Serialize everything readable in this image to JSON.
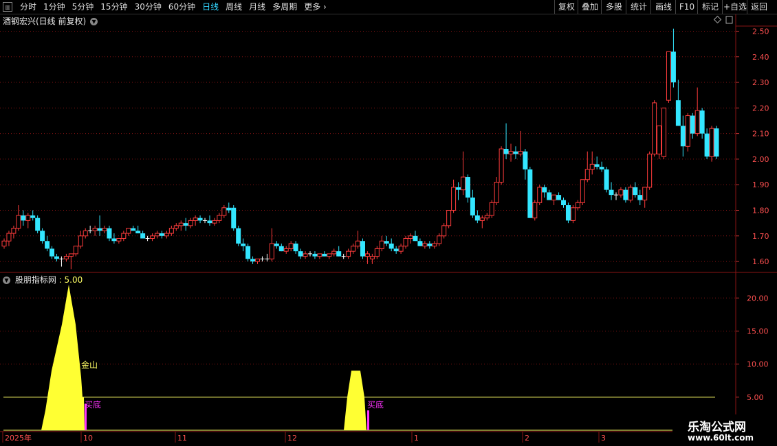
{
  "toolbar": {
    "periods": [
      "分时",
      "1分钟",
      "5分钟",
      "15分钟",
      "30分钟",
      "60分钟",
      "日线",
      "周线",
      "月线",
      "多周期",
      "更多"
    ],
    "active_period": "日线",
    "right_buttons": [
      "复权",
      "叠加",
      "多股",
      "统计",
      "画线",
      "F10",
      "标记",
      "+自选",
      "返回"
    ]
  },
  "main_panel": {
    "title": "酒钢宏兴(日线 前复权)",
    "y_ticks": [
      "2.50",
      "2.40",
      "2.30",
      "2.20",
      "2.10",
      "2.00",
      "1.90",
      "1.80",
      "1.70",
      "1.60"
    ]
  },
  "indicator_panel": {
    "title": "股朋指标网",
    "value": ": 5.00",
    "y_ticks": [
      "20.00",
      "15.00",
      "10.00",
      "5.00"
    ],
    "labels": {
      "jinshan": "金山",
      "buy1": "买底",
      "buy2": "买底"
    }
  },
  "x_axis": {
    "labels": [
      "2025年",
      "10",
      "11",
      "12",
      "1",
      "2",
      "3"
    ]
  },
  "colors": {
    "up": "#ff3c3c",
    "down": "#33e6ff",
    "doji": "#ffffff",
    "area": "#ffff33",
    "buy": "#ff33ff",
    "grid": "#8a1414"
  },
  "chart_data": {
    "type": "candlestick",
    "ylim": [
      1.56,
      2.52
    ],
    "candles": [
      [
        1.66,
        1.69,
        1.65,
        1.68
      ],
      [
        1.68,
        1.72,
        1.66,
        1.71
      ],
      [
        1.71,
        1.74,
        1.69,
        1.73
      ],
      [
        1.73,
        1.82,
        1.72,
        1.78
      ],
      [
        1.78,
        1.8,
        1.74,
        1.76
      ],
      [
        1.76,
        1.79,
        1.73,
        1.78
      ],
      [
        1.78,
        1.8,
        1.76,
        1.77
      ],
      [
        1.77,
        1.78,
        1.71,
        1.72
      ],
      [
        1.72,
        1.73,
        1.67,
        1.68
      ],
      [
        1.68,
        1.7,
        1.64,
        1.65
      ],
      [
        1.65,
        1.66,
        1.61,
        1.62
      ],
      [
        1.62,
        1.63,
        1.6,
        1.61
      ],
      [
        1.61,
        1.62,
        1.58,
        1.61
      ],
      [
        1.61,
        1.63,
        1.6,
        1.62
      ],
      [
        1.62,
        1.63,
        1.57,
        1.63
      ],
      [
        1.63,
        1.66,
        1.62,
        1.66
      ],
      [
        1.66,
        1.72,
        1.65,
        1.7
      ],
      [
        1.7,
        1.73,
        1.69,
        1.72
      ],
      [
        1.72,
        1.74,
        1.71,
        1.72
      ],
      [
        1.72,
        1.74,
        1.7,
        1.73
      ],
      [
        1.73,
        1.78,
        1.7,
        1.72
      ],
      [
        1.72,
        1.74,
        1.71,
        1.73
      ],
      [
        1.73,
        1.74,
        1.68,
        1.69
      ],
      [
        1.69,
        1.71,
        1.67,
        1.68
      ],
      [
        1.68,
        1.69,
        1.67,
        1.69
      ],
      [
        1.69,
        1.72,
        1.68,
        1.71
      ],
      [
        1.71,
        1.73,
        1.7,
        1.73
      ],
      [
        1.73,
        1.74,
        1.72,
        1.72
      ],
      [
        1.72,
        1.74,
        1.71,
        1.71
      ],
      [
        1.71,
        1.72,
        1.69,
        1.69
      ],
      [
        1.69,
        1.7,
        1.68,
        1.69
      ],
      [
        1.69,
        1.71,
        1.68,
        1.7
      ],
      [
        1.7,
        1.72,
        1.69,
        1.71
      ],
      [
        1.71,
        1.72,
        1.69,
        1.7
      ],
      [
        1.7,
        1.72,
        1.69,
        1.71
      ],
      [
        1.71,
        1.74,
        1.7,
        1.73
      ],
      [
        1.73,
        1.75,
        1.72,
        1.74
      ],
      [
        1.74,
        1.76,
        1.72,
        1.75
      ],
      [
        1.75,
        1.77,
        1.72,
        1.74
      ],
      [
        1.74,
        1.77,
        1.73,
        1.76
      ],
      [
        1.76,
        1.78,
        1.74,
        1.77
      ],
      [
        1.77,
        1.78,
        1.75,
        1.76
      ],
      [
        1.76,
        1.77,
        1.75,
        1.76
      ],
      [
        1.76,
        1.78,
        1.74,
        1.75
      ],
      [
        1.75,
        1.77,
        1.74,
        1.76
      ],
      [
        1.76,
        1.79,
        1.75,
        1.78
      ],
      [
        1.78,
        1.82,
        1.77,
        1.81
      ],
      [
        1.81,
        1.83,
        1.79,
        1.8
      ],
      [
        1.81,
        1.82,
        1.72,
        1.73
      ],
      [
        1.73,
        1.74,
        1.66,
        1.67
      ],
      [
        1.67,
        1.69,
        1.64,
        1.66
      ],
      [
        1.66,
        1.67,
        1.6,
        1.61
      ],
      [
        1.61,
        1.62,
        1.59,
        1.6
      ],
      [
        1.6,
        1.61,
        1.59,
        1.61
      ],
      [
        1.61,
        1.62,
        1.6,
        1.61
      ],
      [
        1.61,
        1.63,
        1.6,
        1.61
      ],
      [
        1.61,
        1.73,
        1.6,
        1.67
      ],
      [
        1.67,
        1.68,
        1.65,
        1.66
      ],
      [
        1.66,
        1.67,
        1.64,
        1.64
      ],
      [
        1.64,
        1.66,
        1.63,
        1.65
      ],
      [
        1.65,
        1.68,
        1.64,
        1.67
      ],
      [
        1.67,
        1.68,
        1.63,
        1.64
      ],
      [
        1.64,
        1.65,
        1.61,
        1.62
      ],
      [
        1.62,
        1.64,
        1.61,
        1.63
      ],
      [
        1.63,
        1.64,
        1.62,
        1.63
      ],
      [
        1.63,
        1.64,
        1.61,
        1.62
      ],
      [
        1.62,
        1.63,
        1.61,
        1.63
      ],
      [
        1.63,
        1.64,
        1.62,
        1.62
      ],
      [
        1.62,
        1.63,
        1.61,
        1.63
      ],
      [
        1.63,
        1.65,
        1.62,
        1.64
      ],
      [
        1.64,
        1.66,
        1.62,
        1.62
      ],
      [
        1.62,
        1.63,
        1.61,
        1.62
      ],
      [
        1.62,
        1.65,
        1.61,
        1.64
      ],
      [
        1.64,
        1.67,
        1.63,
        1.66
      ],
      [
        1.66,
        1.72,
        1.65,
        1.68
      ],
      [
        1.68,
        1.69,
        1.61,
        1.62
      ],
      [
        1.62,
        1.64,
        1.59,
        1.63
      ],
      [
        1.61,
        1.63,
        1.59,
        1.62
      ],
      [
        1.62,
        1.66,
        1.61,
        1.65
      ],
      [
        1.65,
        1.7,
        1.64,
        1.68
      ],
      [
        1.68,
        1.7,
        1.66,
        1.67
      ],
      [
        1.67,
        1.69,
        1.64,
        1.65
      ],
      [
        1.65,
        1.66,
        1.63,
        1.64
      ],
      [
        1.64,
        1.67,
        1.63,
        1.66
      ],
      [
        1.66,
        1.7,
        1.65,
        1.69
      ],
      [
        1.69,
        1.71,
        1.67,
        1.7
      ],
      [
        1.7,
        1.72,
        1.68,
        1.68
      ],
      [
        1.68,
        1.69,
        1.66,
        1.66
      ],
      [
        1.66,
        1.68,
        1.65,
        1.67
      ],
      [
        1.67,
        1.68,
        1.65,
        1.66
      ],
      [
        1.66,
        1.68,
        1.65,
        1.67
      ],
      [
        1.67,
        1.71,
        1.66,
        1.7
      ],
      [
        1.7,
        1.75,
        1.69,
        1.74
      ],
      [
        1.74,
        1.8,
        1.73,
        1.8
      ],
      [
        1.8,
        1.92,
        1.79,
        1.89
      ],
      [
        1.89,
        1.91,
        1.84,
        1.88
      ],
      [
        1.88,
        2.03,
        1.86,
        1.93
      ],
      [
        1.93,
        1.94,
        1.83,
        1.85
      ],
      [
        1.85,
        1.88,
        1.77,
        1.78
      ],
      [
        1.78,
        1.8,
        1.75,
        1.76
      ],
      [
        1.76,
        1.78,
        1.73,
        1.77
      ],
      [
        1.77,
        1.79,
        1.76,
        1.78
      ],
      [
        1.78,
        1.84,
        1.77,
        1.83
      ],
      [
        1.83,
        1.93,
        1.82,
        1.91
      ],
      [
        1.91,
        2.05,
        1.9,
        2.04
      ],
      [
        2.04,
        2.14,
        2.0,
        2.02
      ],
      [
        2.02,
        2.06,
        1.99,
        2.03
      ],
      [
        2.03,
        2.05,
        2.0,
        2.02
      ],
      [
        2.02,
        2.11,
        2.01,
        2.03
      ],
      [
        2.03,
        2.04,
        1.92,
        1.96
      ],
      [
        1.96,
        1.97,
        1.77,
        1.77
      ],
      [
        1.77,
        1.84,
        1.76,
        1.83
      ],
      [
        1.83,
        1.9,
        1.82,
        1.89
      ],
      [
        1.89,
        1.9,
        1.85,
        1.87
      ],
      [
        1.87,
        1.88,
        1.84,
        1.84
      ],
      [
        1.84,
        1.86,
        1.82,
        1.86
      ],
      [
        1.86,
        1.87,
        1.84,
        1.84
      ],
      [
        1.84,
        1.85,
        1.81,
        1.82
      ],
      [
        1.82,
        1.83,
        1.75,
        1.76
      ],
      [
        1.76,
        1.82,
        1.75,
        1.81
      ],
      [
        1.81,
        1.84,
        1.8,
        1.83
      ],
      [
        1.83,
        1.92,
        1.82,
        1.92
      ],
      [
        1.92,
        2.03,
        1.91,
        1.96
      ],
      [
        1.96,
        2.03,
        1.94,
        1.98
      ],
      [
        1.98,
        2.01,
        1.96,
        1.97
      ],
      [
        1.97,
        1.99,
        1.95,
        1.96
      ],
      [
        1.96,
        1.97,
        1.87,
        1.88
      ],
      [
        1.88,
        1.91,
        1.84,
        1.86
      ],
      [
        1.86,
        1.87,
        1.84,
        1.86
      ],
      [
        1.86,
        1.89,
        1.85,
        1.88
      ],
      [
        1.88,
        1.89,
        1.83,
        1.84
      ],
      [
        1.84,
        1.9,
        1.83,
        1.89
      ],
      [
        1.89,
        1.91,
        1.85,
        1.86
      ],
      [
        1.86,
        1.88,
        1.82,
        1.84
      ],
      [
        1.84,
        1.89,
        1.81,
        1.89
      ],
      [
        1.89,
        2.03,
        1.88,
        2.02
      ],
      [
        2.02,
        2.23,
        2.01,
        2.22
      ],
      [
        2.02,
        2.13,
        2.0,
        2.13
      ],
      [
        2.01,
        2.2,
        2.0,
        2.2
      ],
      [
        2.23,
        2.42,
        2.22,
        2.42
      ],
      [
        2.42,
        2.51,
        2.28,
        2.3
      ],
      [
        2.23,
        2.31,
        2.13,
        2.13
      ],
      [
        2.13,
        2.17,
        2.01,
        2.05
      ],
      [
        2.05,
        2.18,
        2.03,
        2.17
      ],
      [
        2.17,
        2.18,
        2.08,
        2.1
      ],
      [
        2.1,
        2.28,
        2.09,
        2.19
      ],
      [
        2.19,
        2.2,
        2.08,
        2.1
      ],
      [
        2.1,
        2.12,
        2.0,
        2.01
      ],
      [
        2.01,
        2.13,
        1.99,
        2.12
      ],
      [
        2.12,
        2.13,
        2.0,
        2.01
      ]
    ],
    "indicator": {
      "ylim": [
        0,
        22
      ],
      "ref_line": 5,
      "areas": [
        {
          "values": [
            [
              60,
              0
            ],
            [
              66,
              3
            ],
            [
              75,
              9
            ],
            [
              90,
              16
            ],
            [
              100,
              22
            ],
            [
              110,
              16
            ],
            [
              118,
              8
            ],
            [
              120,
              5
            ],
            [
              122,
              5
            ],
            [
              123,
              0
            ]
          ]
        },
        {
          "values": [
            [
              500,
              0
            ],
            [
              505,
              5
            ],
            [
              511,
              9
            ],
            [
              524,
              9
            ],
            [
              530,
              5
            ],
            [
              533,
              0
            ]
          ]
        }
      ],
      "buy_bars": [
        [
          123,
          4
        ],
        [
          534,
          3
        ]
      ]
    }
  }
}
